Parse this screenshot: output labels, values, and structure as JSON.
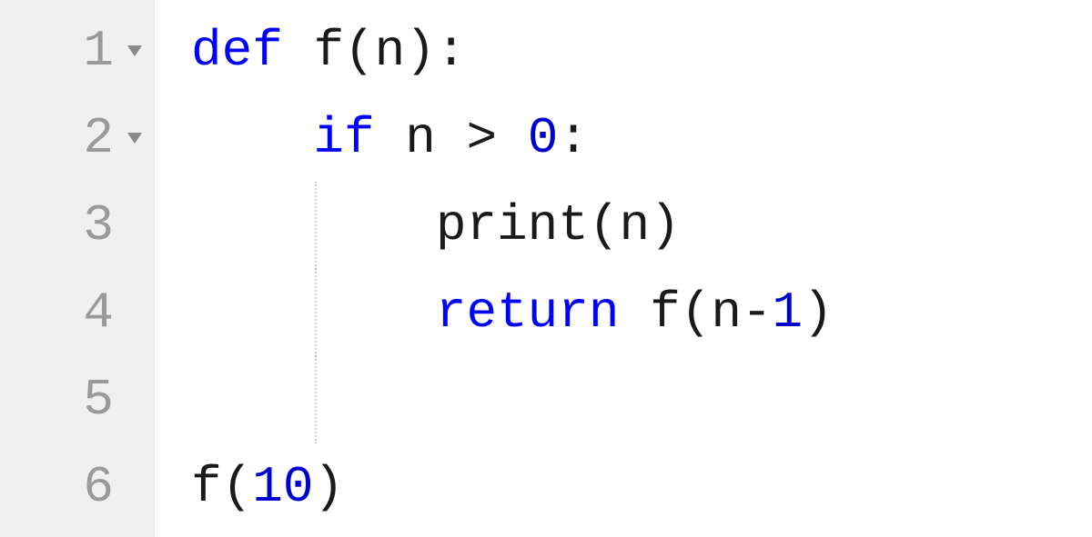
{
  "gutter": {
    "lines": [
      "1",
      "2",
      "3",
      "4",
      "5",
      "6"
    ],
    "foldable": [
      true,
      true,
      false,
      false,
      false,
      false
    ]
  },
  "code": {
    "tokens": [
      [
        {
          "cls": "kw",
          "t": "def"
        },
        {
          "cls": "",
          "t": " "
        },
        {
          "cls": "id",
          "t": "f"
        },
        {
          "cls": "punc",
          "t": "("
        },
        {
          "cls": "id",
          "t": "n"
        },
        {
          "cls": "punc",
          "t": ")"
        },
        {
          "cls": "punc",
          "t": ":"
        }
      ],
      [
        {
          "cls": "",
          "t": "    "
        },
        {
          "cls": "kw",
          "t": "if"
        },
        {
          "cls": "",
          "t": " "
        },
        {
          "cls": "id",
          "t": "n"
        },
        {
          "cls": "",
          "t": " "
        },
        {
          "cls": "op",
          "t": ">"
        },
        {
          "cls": "",
          "t": " "
        },
        {
          "cls": "num",
          "t": "0"
        },
        {
          "cls": "punc",
          "t": ":"
        }
      ],
      [
        {
          "cls": "",
          "t": "        "
        },
        {
          "cls": "id",
          "t": "print"
        },
        {
          "cls": "punc",
          "t": "("
        },
        {
          "cls": "id",
          "t": "n"
        },
        {
          "cls": "punc",
          "t": ")"
        }
      ],
      [
        {
          "cls": "",
          "t": "        "
        },
        {
          "cls": "kw",
          "t": "return"
        },
        {
          "cls": "",
          "t": " "
        },
        {
          "cls": "id",
          "t": "f"
        },
        {
          "cls": "punc",
          "t": "("
        },
        {
          "cls": "id",
          "t": "n"
        },
        {
          "cls": "op",
          "t": "-"
        },
        {
          "cls": "num",
          "t": "1"
        },
        {
          "cls": "punc",
          "t": ")"
        }
      ],
      [],
      [
        {
          "cls": "id",
          "t": "f"
        },
        {
          "cls": "punc",
          "t": "("
        },
        {
          "cls": "num",
          "t": "10"
        },
        {
          "cls": "punc",
          "t": ")"
        }
      ]
    ],
    "indentGuides": [
      [],
      [],
      [
        1
      ],
      [
        1
      ],
      [
        1
      ],
      []
    ]
  }
}
